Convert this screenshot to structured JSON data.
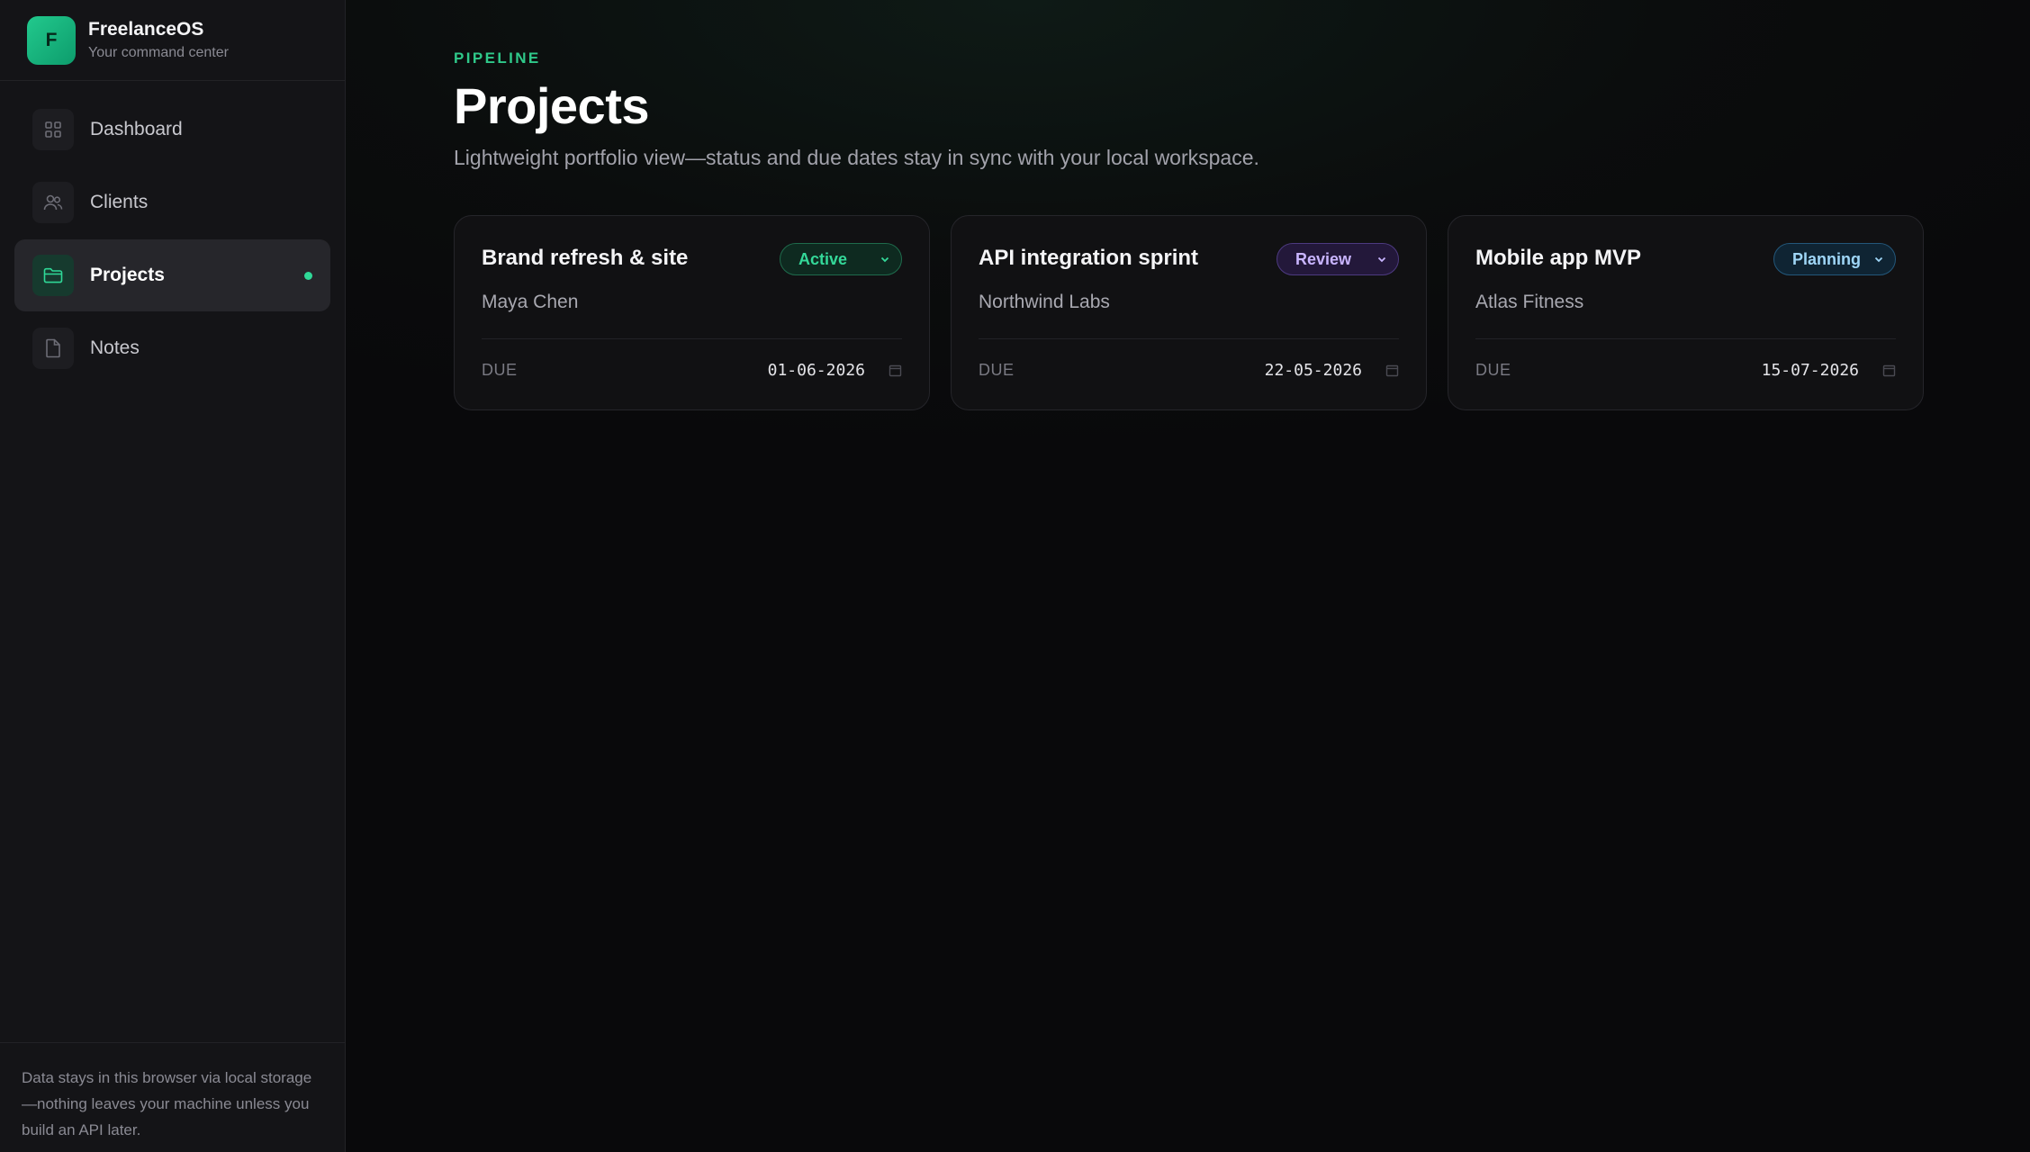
{
  "brand": {
    "logo_letter": "F",
    "name": "FreelanceOS",
    "tagline": "Your command center"
  },
  "sidebar": {
    "items": [
      {
        "label": "Dashboard",
        "icon": "grid-icon",
        "active": false
      },
      {
        "label": "Clients",
        "icon": "users-icon",
        "active": false
      },
      {
        "label": "Projects",
        "icon": "folder-icon",
        "active": true
      },
      {
        "label": "Notes",
        "icon": "file-icon",
        "active": false
      }
    ],
    "footer": "Data stays in this browser via local storage—nothing leaves your machine unless you build an API later."
  },
  "header": {
    "eyebrow": "PIPELINE",
    "title": "Projects",
    "description": "Lightweight portfolio view—status and due dates stay in sync with your local workspace."
  },
  "projects": [
    {
      "title": "Brand refresh & site",
      "client": "Maya Chen",
      "status": "Active",
      "due_label": "DUE",
      "due": "01-06-2026"
    },
    {
      "title": "API integration sprint",
      "client": "Northwind Labs",
      "status": "Review",
      "due_label": "DUE",
      "due": "22-05-2026"
    },
    {
      "title": "Mobile app MVP",
      "client": "Atlas Fitness",
      "status": "Planning",
      "due_label": "DUE",
      "due": "15-07-2026"
    }
  ],
  "colors": {
    "accent": "#2fc98a",
    "active_status": "#34d899",
    "review_status": "#c9b5ff",
    "planning_status": "#9fd6f7"
  }
}
